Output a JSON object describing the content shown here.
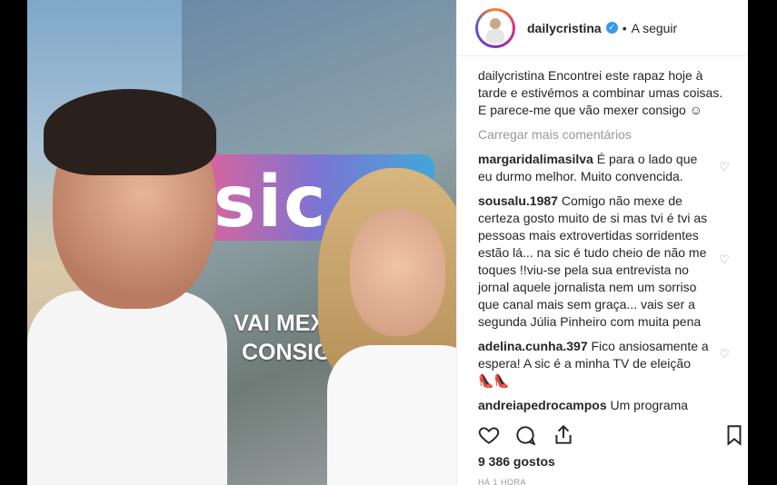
{
  "post": {
    "photo": {
      "logo_text": "sic",
      "slogan": "VAI MEXER CONSIGO"
    }
  },
  "header": {
    "username": "dailycristina",
    "separator": "•",
    "follow_label": "A seguir"
  },
  "caption": {
    "username": "dailycristina",
    "text": "Encontrei este rapaz hoje à tarde e estivémos a combinar umas coisas. E parece-me que vão mexer consigo ☺"
  },
  "load_more_label": "Carregar mais comentários",
  "comments": [
    {
      "username": "margaridalimasilva",
      "text": "É para o lado que eu durmo melhor. Muito convencida."
    },
    {
      "username": "sousalu.1987",
      "text": "Comigo não mexe de certeza gosto muito de si mas tvi é tvi as pessoas mais extrovertidas sorridentes estão lá... na sic é tudo cheio de não me toques !!viu-se pela sua entrevista no jornal aquele jornalista nem um sorriso que canal mais sem graça... vais ser a segunda Júlia Pinheiro com muita pena"
    },
    {
      "username": "adelina.cunha.397",
      "text": "Fico ansiosamente a espera! A sic é a minha TV de eleição 👠👠"
    },
    {
      "username": "andreiapedrocampos",
      "text": "Um programa"
    }
  ],
  "likes": "9 386 gostos",
  "time": "HÁ 1 HORA",
  "icons": [
    "heart-icon",
    "comment-icon",
    "share-icon",
    "bookmark-icon",
    "verified-icon"
  ],
  "colors": {
    "verified": "#3897f0",
    "muted": "#999999",
    "text": "#262626"
  }
}
